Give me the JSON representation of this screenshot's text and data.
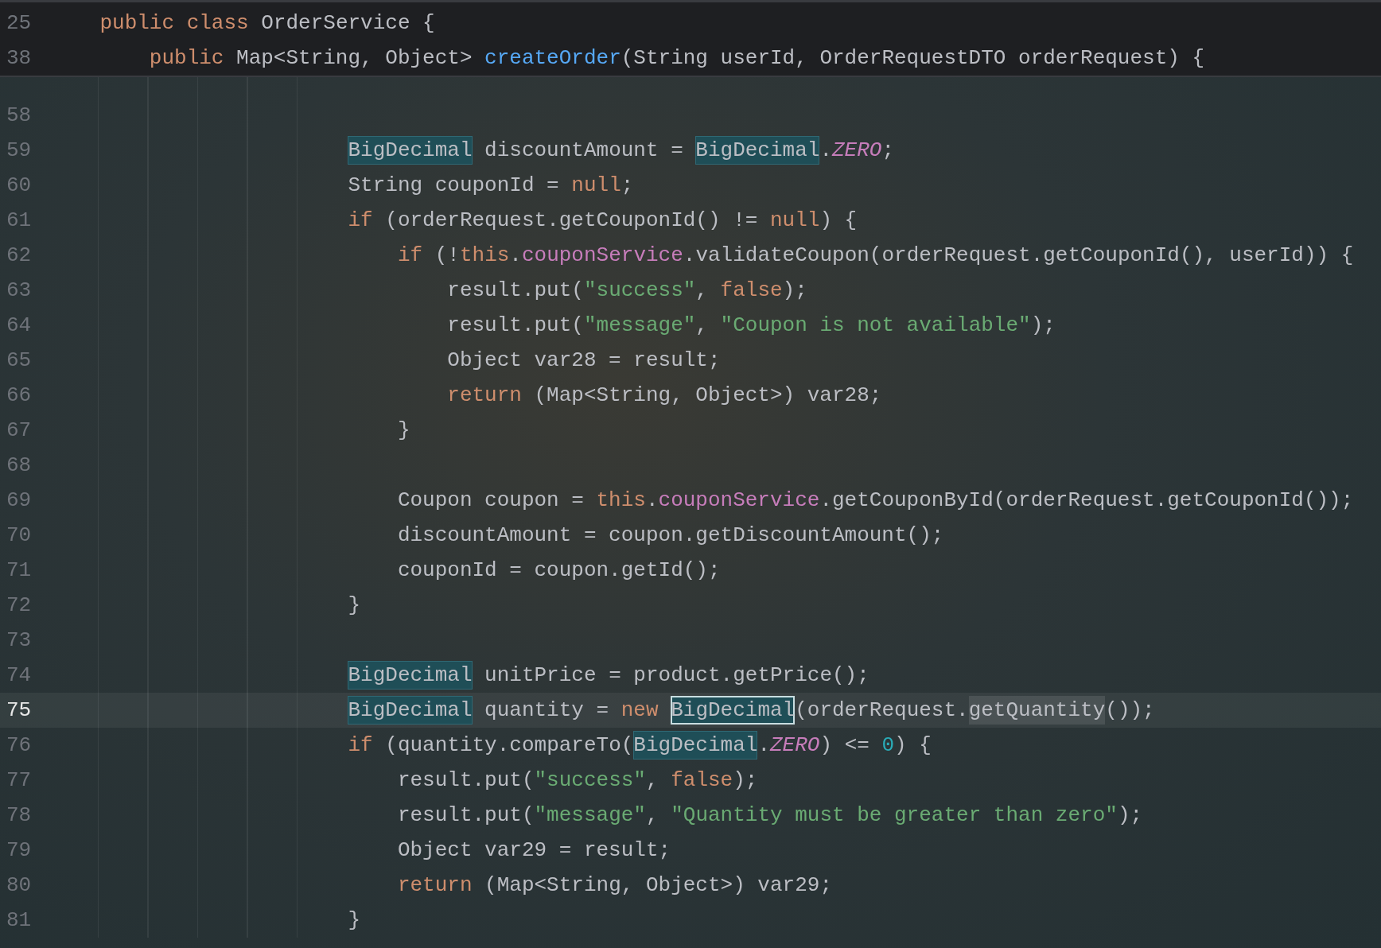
{
  "sticky_lines": [
    {
      "number": "25",
      "tokens": [
        {
          "text": "    public class ",
          "kind": "keyword"
        },
        {
          "text": "OrderService {",
          "kind": "plain"
        }
      ]
    },
    {
      "number": "38",
      "tokens": [
        {
          "text": "        public ",
          "kind": "keyword"
        },
        {
          "text": "Map<String, Object> ",
          "kind": "plain"
        },
        {
          "text": "createOrder",
          "kind": "declaration"
        },
        {
          "text": "(String userId, OrderRequestDTO orderRequest) {",
          "kind": "plain"
        }
      ]
    }
  ],
  "lines": [
    {
      "number": "58",
      "current": false
    },
    {
      "number": "59",
      "current": false,
      "tokens": [
        {
          "text": "                        BigDecimal",
          "kind": "usage"
        },
        {
          "text": " discountAmount = ",
          "kind": "plain"
        },
        {
          "text": "BigDecimal",
          "kind": "usage"
        },
        {
          "text": ".",
          "kind": "plain"
        },
        {
          "text": "ZERO",
          "kind": "static"
        },
        {
          "text": ";",
          "kind": "plain"
        }
      ]
    },
    {
      "number": "60",
      "current": false,
      "tokens": [
        {
          "text": "                        String couponId = ",
          "kind": "plain"
        },
        {
          "text": "null",
          "kind": "keyword"
        },
        {
          "text": ";",
          "kind": "plain"
        }
      ]
    },
    {
      "number": "61",
      "current": false,
      "tokens": [
        {
          "text": "                        if",
          "kind": "keyword"
        },
        {
          "text": " (orderRequest.getCouponId() != ",
          "kind": "plain"
        },
        {
          "text": "null",
          "kind": "keyword"
        },
        {
          "text": ") {",
          "kind": "plain"
        }
      ]
    },
    {
      "number": "62",
      "current": false,
      "tokens": [
        {
          "text": "                            if",
          "kind": "keyword"
        },
        {
          "text": " (!",
          "kind": "plain"
        },
        {
          "text": "this",
          "kind": "keyword"
        },
        {
          "text": ".",
          "kind": "plain"
        },
        {
          "text": "couponService",
          "kind": "field"
        },
        {
          "text": ".validateCoupon(orderRequest.getCouponId(), userId)) {",
          "kind": "plain"
        }
      ]
    },
    {
      "number": "63",
      "current": false,
      "tokens": [
        {
          "text": "                                result.put(",
          "kind": "plain"
        },
        {
          "text": "\"success\"",
          "kind": "string"
        },
        {
          "text": ", ",
          "kind": "plain"
        },
        {
          "text": "false",
          "kind": "keyword"
        },
        {
          "text": ");",
          "kind": "plain"
        }
      ]
    },
    {
      "number": "64",
      "current": false,
      "tokens": [
        {
          "text": "                                result.put(",
          "kind": "plain"
        },
        {
          "text": "\"message\"",
          "kind": "string"
        },
        {
          "text": ", ",
          "kind": "plain"
        },
        {
          "text": "\"Coupon is not available\"",
          "kind": "string"
        },
        {
          "text": ");",
          "kind": "plain"
        }
      ]
    },
    {
      "number": "65",
      "current": false,
      "tokens": [
        {
          "text": "                                Object var28 = result;",
          "kind": "plain"
        }
      ]
    },
    {
      "number": "66",
      "current": false,
      "tokens": [
        {
          "text": "                                return",
          "kind": "keyword"
        },
        {
          "text": " (Map<String, Object>) var28;",
          "kind": "plain"
        }
      ]
    },
    {
      "number": "67",
      "current": false,
      "tokens": [
        {
          "text": "                            }",
          "kind": "plain"
        }
      ]
    },
    {
      "number": "68",
      "current": false
    },
    {
      "number": "69",
      "current": false,
      "tokens": [
        {
          "text": "                            Coupon coupon = ",
          "kind": "plain"
        },
        {
          "text": "this",
          "kind": "keyword"
        },
        {
          "text": ".",
          "kind": "plain"
        },
        {
          "text": "couponService",
          "kind": "field"
        },
        {
          "text": ".getCouponById(orderRequest.getCouponId());",
          "kind": "plain"
        }
      ]
    },
    {
      "number": "70",
      "current": false,
      "tokens": [
        {
          "text": "                            discountAmount = coupon.getDiscountAmount();",
          "kind": "plain"
        }
      ]
    },
    {
      "number": "71",
      "current": false,
      "tokens": [
        {
          "text": "                            couponId = coupon.getId();",
          "kind": "plain"
        }
      ]
    },
    {
      "number": "72",
      "current": false,
      "tokens": [
        {
          "text": "                        }",
          "kind": "plain"
        }
      ]
    },
    {
      "number": "73",
      "current": false
    },
    {
      "number": "74",
      "current": false,
      "tokens": [
        {
          "text": "                        BigDecimal",
          "kind": "usage"
        },
        {
          "text": " unitPrice = product.getPrice();",
          "kind": "plain"
        }
      ]
    },
    {
      "number": "75",
      "current": true,
      "tokens": [
        {
          "text": "                        BigDecimal",
          "kind": "usage"
        },
        {
          "text": " quantity = ",
          "kind": "plain"
        },
        {
          "text": "new ",
          "kind": "keyword"
        },
        {
          "text": "BigDecimal",
          "kind": "usage-caret"
        },
        {
          "text": "(orderRequest.",
          "kind": "plain"
        },
        {
          "text": "getQuantity",
          "kind": "read"
        },
        {
          "text": "());",
          "kind": "plain"
        }
      ]
    },
    {
      "number": "76",
      "current": false,
      "tokens": [
        {
          "text": "                        if",
          "kind": "keyword"
        },
        {
          "text": " (quantity.compareTo(",
          "kind": "plain"
        },
        {
          "text": "BigDecimal",
          "kind": "usage"
        },
        {
          "text": ".",
          "kind": "plain"
        },
        {
          "text": "ZERO",
          "kind": "static"
        },
        {
          "text": ") <= ",
          "kind": "plain"
        },
        {
          "text": "0",
          "kind": "number"
        },
        {
          "text": ") {",
          "kind": "plain"
        }
      ]
    },
    {
      "number": "77",
      "current": false,
      "tokens": [
        {
          "text": "                            result.put(",
          "kind": "plain"
        },
        {
          "text": "\"success\"",
          "kind": "string"
        },
        {
          "text": ", ",
          "kind": "plain"
        },
        {
          "text": "false",
          "kind": "keyword"
        },
        {
          "text": ");",
          "kind": "plain"
        }
      ]
    },
    {
      "number": "78",
      "current": false,
      "tokens": [
        {
          "text": "                            result.put(",
          "kind": "plain"
        },
        {
          "text": "\"message\"",
          "kind": "string"
        },
        {
          "text": ", ",
          "kind": "plain"
        },
        {
          "text": "\"Quantity must be greater than zero\"",
          "kind": "string"
        },
        {
          "text": ");",
          "kind": "plain"
        }
      ]
    },
    {
      "number": "79",
      "current": false,
      "tokens": [
        {
          "text": "                            Object var29 = result;",
          "kind": "plain"
        }
      ]
    },
    {
      "number": "80",
      "current": false,
      "tokens": [
        {
          "text": "                            return",
          "kind": "keyword"
        },
        {
          "text": " (Map<String, Object>) var29;",
          "kind": "plain"
        }
      ]
    },
    {
      "number": "81",
      "current": false,
      "tokens": [
        {
          "text": "                        }",
          "kind": "plain"
        }
      ]
    }
  ]
}
